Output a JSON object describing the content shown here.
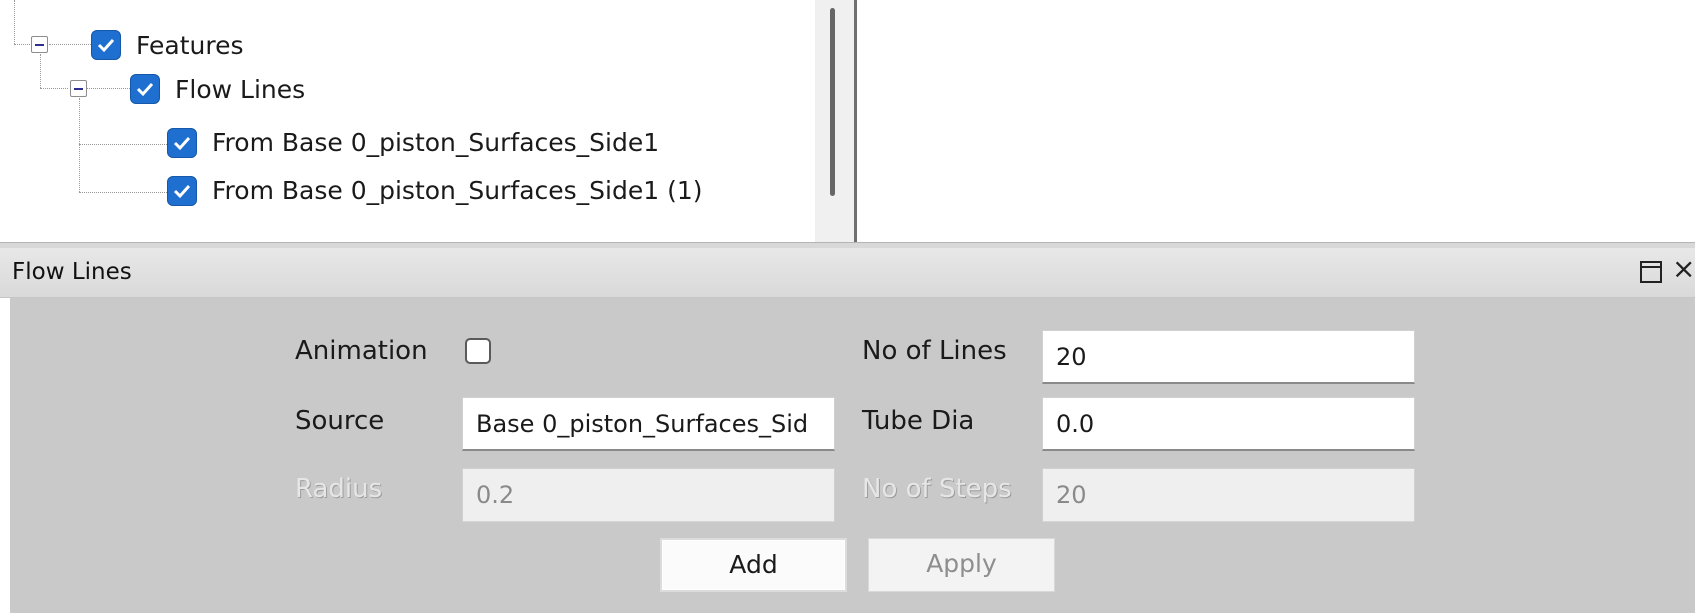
{
  "tree": {
    "items": [
      {
        "label": "Features",
        "checked": true,
        "expanded": true
      },
      {
        "label": "Flow Lines",
        "checked": true,
        "expanded": true
      },
      {
        "label": "From Base 0_piston_Surfaces_Side1",
        "checked": true
      },
      {
        "label": "From Base 0_piston_Surfaces_Side1 (1)",
        "checked": true
      }
    ]
  },
  "panel": {
    "title": "Flow Lines",
    "float_icon": "restore-window-icon",
    "close_glyph": "×"
  },
  "form": {
    "animation_label": "Animation",
    "animation_checked": false,
    "source_label": "Source",
    "source_value": "Base 0_piston_Surfaces_Sid",
    "radius_label": "Radius",
    "radius_value": "0.2",
    "lines_label": "No of Lines",
    "lines_value": "20",
    "tube_label": "Tube Dia",
    "tube_value": "0.0",
    "steps_label": "No of Steps",
    "steps_value": "20",
    "add_label": "Add",
    "apply_label": "Apply"
  },
  "colors": {
    "checkbox_blue": "#1e6fd0",
    "panel_gray": "#c9c9c9",
    "titlebar_gray": "#dcdcdc"
  }
}
